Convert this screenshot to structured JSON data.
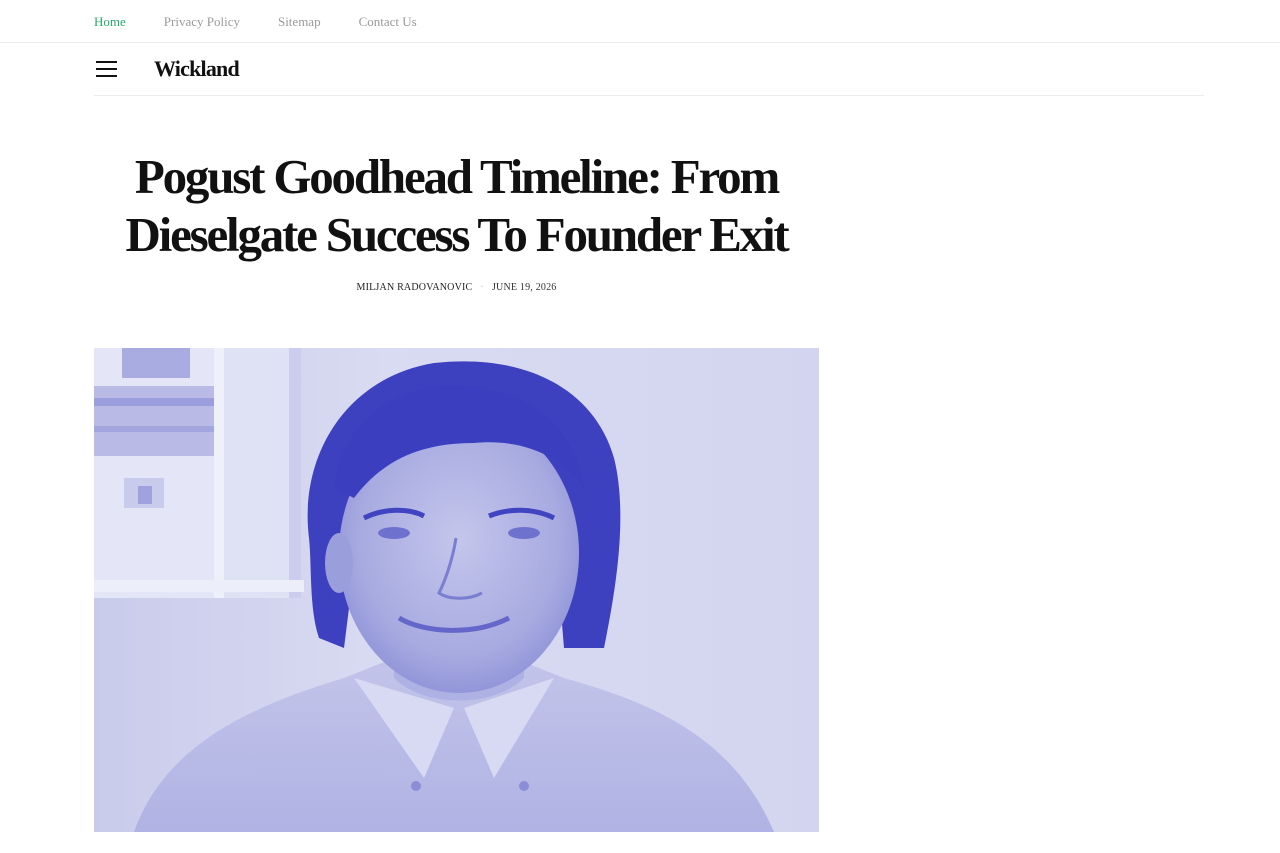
{
  "topnav": {
    "items": [
      {
        "label": "Home",
        "active": true
      },
      {
        "label": "Privacy Policy",
        "active": false
      },
      {
        "label": "Sitemap",
        "active": false
      },
      {
        "label": "Contact Us",
        "active": false
      }
    ]
  },
  "header": {
    "logo": "Wickland",
    "menu_icon": "hamburger-menu-icon"
  },
  "article": {
    "title": "Pogust Goodhead Timeline: From Dieselgate Success To Founder Exit",
    "author": "MILJAN RADOVANOVIC",
    "separator": "·",
    "date": "JUNE 19, 2026"
  },
  "colors": {
    "accent": "#2aa86b",
    "duotone_dark": "#3b3fbf",
    "duotone_light": "#d6d8f1"
  }
}
